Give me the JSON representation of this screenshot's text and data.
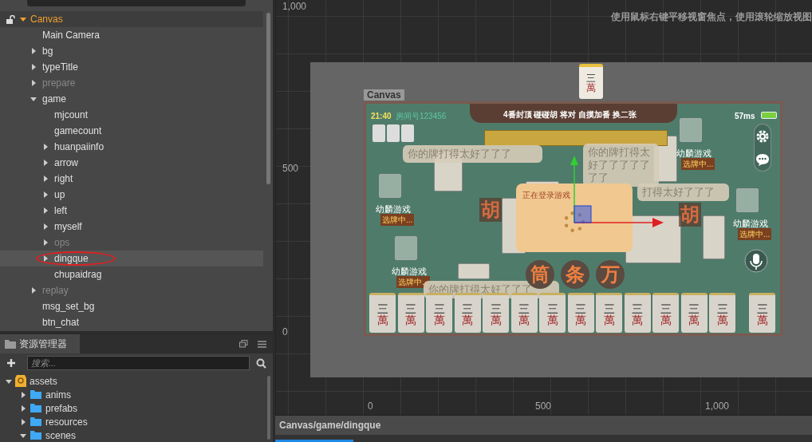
{
  "hierarchy": {
    "root": {
      "label": "Canvas",
      "expanded": true,
      "children": [
        {
          "label": "Main Camera",
          "collapsible": false,
          "active": true,
          "selected": false,
          "circled": false
        },
        {
          "label": "bg",
          "collapsible": true,
          "expanded": false,
          "active": true,
          "selected": false,
          "circled": false
        },
        {
          "label": "typeTitle",
          "collapsible": true,
          "expanded": false,
          "active": true,
          "selected": false,
          "circled": false
        },
        {
          "label": "prepare",
          "collapsible": true,
          "expanded": false,
          "active": false,
          "selected": false,
          "circled": false
        },
        {
          "label": "game",
          "collapsible": true,
          "expanded": true,
          "active": true,
          "selected": false,
          "circled": false,
          "children": [
            {
              "label": "mjcount",
              "collapsible": false,
              "active": true,
              "selected": false,
              "circled": false
            },
            {
              "label": "gamecount",
              "collapsible": false,
              "active": true,
              "selected": false,
              "circled": false
            },
            {
              "label": "huanpaiinfo",
              "collapsible": true,
              "expanded": false,
              "active": true,
              "selected": false,
              "circled": false
            },
            {
              "label": "arrow",
              "collapsible": true,
              "expanded": false,
              "active": true,
              "selected": false,
              "circled": false
            },
            {
              "label": "right",
              "collapsible": true,
              "expanded": false,
              "active": true,
              "selected": false,
              "circled": false
            },
            {
              "label": "up",
              "collapsible": true,
              "expanded": false,
              "active": true,
              "selected": false,
              "circled": false
            },
            {
              "label": "left",
              "collapsible": true,
              "expanded": false,
              "active": true,
              "selected": false,
              "circled": false
            },
            {
              "label": "myself",
              "collapsible": true,
              "expanded": false,
              "active": true,
              "selected": false,
              "circled": false
            },
            {
              "label": "ops",
              "collapsible": true,
              "expanded": false,
              "active": false,
              "selected": false,
              "circled": false
            },
            {
              "label": "dingque",
              "collapsible": true,
              "expanded": false,
              "active": true,
              "selected": true,
              "circled": true
            },
            {
              "label": "chupaidrag",
              "collapsible": false,
              "active": true,
              "selected": false,
              "circled": false
            }
          ]
        },
        {
          "label": "replay",
          "collapsible": true,
          "expanded": false,
          "active": false,
          "selected": false,
          "circled": false
        },
        {
          "label": "msg_set_bg",
          "collapsible": false,
          "active": true,
          "selected": false,
          "circled": false
        },
        {
          "label": "btn_chat",
          "collapsible": false,
          "active": true,
          "selected": false,
          "circled": false
        }
      ]
    }
  },
  "assets": {
    "title": "资源管理器",
    "search": {
      "placeholder": "搜索..."
    },
    "root": {
      "label": "assets",
      "expanded": true,
      "children": [
        {
          "label": "anims",
          "expanded": false
        },
        {
          "label": "prefabs",
          "expanded": false
        },
        {
          "label": "resources",
          "expanded": false
        },
        {
          "label": "scenes",
          "expanded": true
        }
      ]
    }
  },
  "scene": {
    "hint": "使用鼠标右键平移视窗焦点，使用滚轮缩放视图",
    "y_labels": [
      "1,000",
      "500",
      "0"
    ],
    "x_labels": [
      "0",
      "500",
      "1,000"
    ],
    "canvas_label": "Canvas",
    "floating_tile": [
      "三",
      "萬"
    ],
    "game": {
      "time": "21:40",
      "room": "房间号123456",
      "rules": "4番封顶 碰碰胡 将对 自摸加番 换二张",
      "ping": "57ms",
      "bubbles": [
        {
          "text": "你的牌打得太好了了了"
        },
        {
          "text": "你的牌打得太好了了了了了了了"
        },
        {
          "text": "打得太好了了了"
        },
        {
          "text": "你的牌打得太好了了了"
        }
      ],
      "players": [
        {
          "name": "幼麟游戏",
          "status": "选牌中..."
        },
        {
          "name": "幼麟游戏",
          "status": "选牌中..."
        },
        {
          "name": "幼麟游戏",
          "status": "选牌中..."
        },
        {
          "name": "幼麟游戏",
          "status": "选牌中..."
        }
      ],
      "hu_marks": [
        "胡",
        "胡"
      ],
      "loading_text": "正在登录游戏",
      "suits": [
        "筒",
        "条",
        "万"
      ],
      "hand": [
        [
          "三",
          "萬"
        ],
        [
          "三",
          "萬"
        ],
        [
          "三",
          "萬"
        ],
        [
          "三",
          "萬"
        ],
        [
          "三",
          "萬"
        ],
        [
          "三",
          "萬"
        ],
        [
          "三",
          "萬"
        ],
        [
          "三",
          "萬"
        ],
        [
          "三",
          "萬"
        ],
        [
          "三",
          "萬"
        ],
        [
          "三",
          "萬"
        ],
        [
          "三",
          "萬"
        ],
        [
          "三",
          "萬"
        ],
        [
          "三",
          "萬"
        ]
      ]
    }
  },
  "status_bar": {
    "path": "Canvas/game/dingque"
  }
}
